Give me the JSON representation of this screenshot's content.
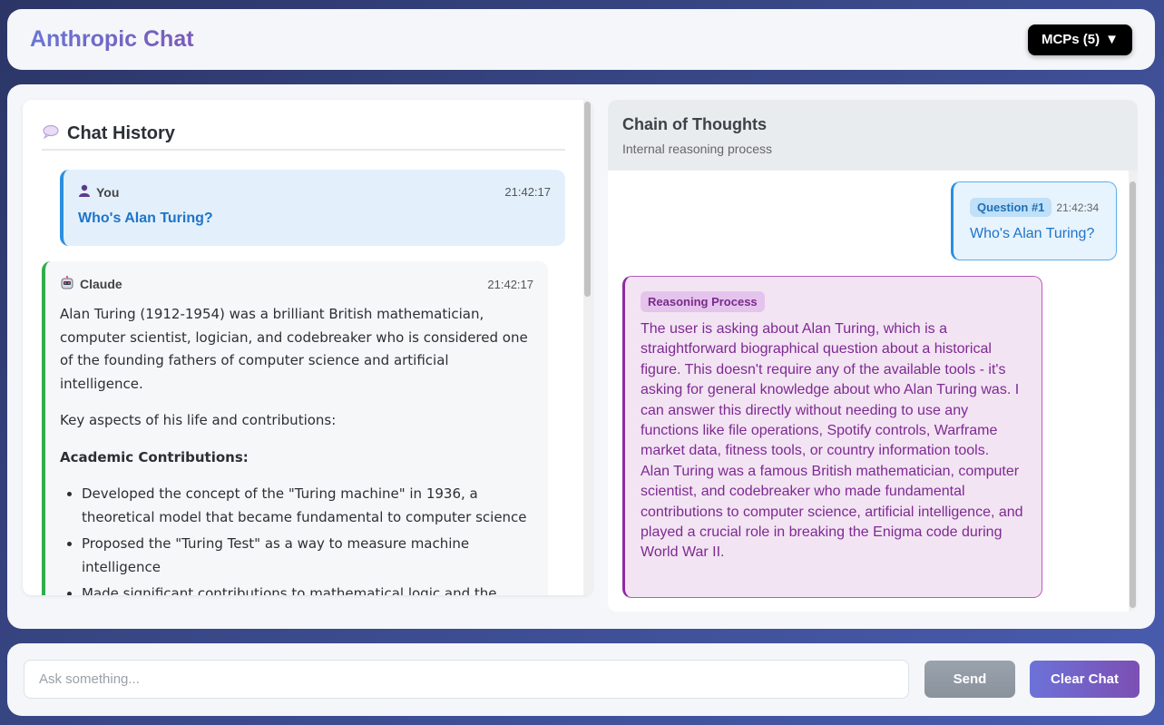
{
  "header": {
    "title": "Anthropic Chat",
    "mcp_button": "MCPs (5)",
    "mcp_arrow": "▼"
  },
  "history": {
    "icon": "speech-bubble-icon",
    "title": "Chat History",
    "messages": [
      {
        "sender": "You",
        "icon": "user-icon",
        "time": "21:42:17",
        "text": "Who's Alan Turing?"
      },
      {
        "sender": "Claude",
        "icon": "robot-icon",
        "time": "21:42:17",
        "paragraphs": [
          "Alan Turing (1912-1954) was a brilliant British mathematician, computer scientist, logician, and codebreaker who is considered one of the founding fathers of computer science and artificial intelligence.",
          "Key aspects of his life and contributions:"
        ],
        "section_heading": "Academic Contributions:",
        "bullets": [
          "Developed the concept of the \"Turing machine\" in 1936, a theoretical model that became fundamental to computer science",
          "Proposed the \"Turing Test\" as a way to measure machine intelligence",
          "Made significant contributions to mathematical logic and the theory of computation"
        ]
      }
    ]
  },
  "thoughts": {
    "title": "Chain of Thoughts",
    "subtitle": "Internal reasoning process",
    "question": {
      "badge": "Question #1",
      "time": "21:42:34",
      "text": "Who's Alan Turing?"
    },
    "reasoning": {
      "badge": "Reasoning Process",
      "text_1": "The user is asking about Alan Turing, which is a straightforward biographical question about a historical figure. This doesn't require any of the available tools - it's asking for general knowledge about who Alan Turing was. I can answer this directly without needing to use any functions like file operations, Spotify controls, Warframe market data, fitness tools, or country information tools.",
      "text_2": "Alan Turing was a famous British mathematician, computer scientist, and codebreaker who made fundamental contributions to computer science, artificial intelligence, and played a crucial role in breaking the Enigma code during World War II."
    }
  },
  "composer": {
    "placeholder": "Ask something...",
    "send_label": "Send",
    "clear_label": "Clear Chat"
  }
}
